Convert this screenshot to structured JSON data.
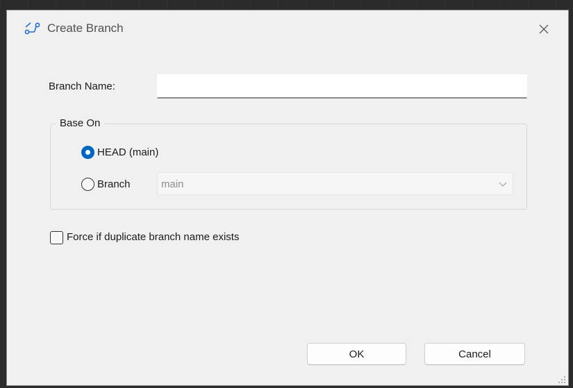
{
  "window": {
    "title": "Create Branch",
    "icon": "branch-icon",
    "close_icon": "close-icon"
  },
  "form": {
    "branch_name_label": "Branch Name:",
    "branch_name_value": "",
    "base_on_label": "Base On",
    "head_option_label": "HEAD (main)",
    "head_option_checked": true,
    "branch_option_label": "Branch",
    "branch_option_checked": false,
    "branch_select_value": "main",
    "force_label": "Force if duplicate branch name exists",
    "force_checked": false
  },
  "buttons": {
    "ok": "OK",
    "cancel": "Cancel"
  },
  "colors": {
    "accent": "#0067c0",
    "dialog_bg": "#f0f0f0"
  }
}
